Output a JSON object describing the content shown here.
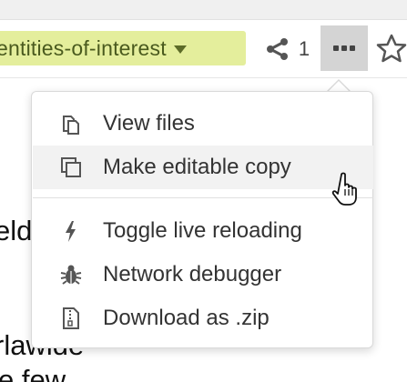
{
  "toolbar": {
    "branch_name": "entities-of-interest",
    "share_count": "1"
  },
  "background_text": {
    "line1": "eld",
    "line2": "rlawide",
    "line3": "e few"
  },
  "menu": {
    "items": [
      {
        "label": "View files",
        "icon": "files-icon"
      },
      {
        "label": "Make editable copy",
        "icon": "copy-icon"
      },
      {
        "label": "Toggle live reloading",
        "icon": "lightning-icon"
      },
      {
        "label": "Network debugger",
        "icon": "bug-icon"
      },
      {
        "label": "Download as .zip",
        "icon": "zip-icon"
      }
    ],
    "hovered_item": "Make editable copy"
  },
  "colors": {
    "branch_bg": "#e4ee9c",
    "branch_text": "#4a5a1e",
    "active_button_bg": "#d4d4d4",
    "menu_hover_bg": "#f2f2f2"
  }
}
